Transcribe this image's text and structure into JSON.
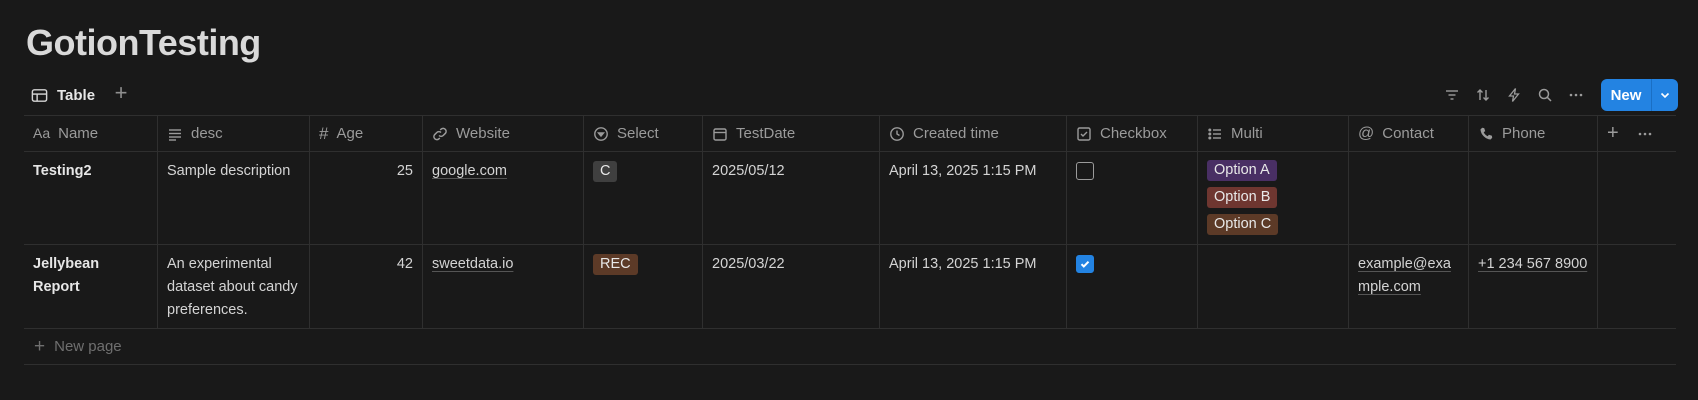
{
  "page": {
    "title": "GotionTesting"
  },
  "view": {
    "tab_label": "Table",
    "new_label": "New",
    "new_page_label": "New page"
  },
  "colors": {
    "accent": "#2383e2",
    "tag_gray": "#3f3f3f",
    "tag_brown": "#5c3a27",
    "tag_purple": "#492f64",
    "tag_red": "#6e3630"
  },
  "columns": {
    "name": "Name",
    "desc": "desc",
    "age": "Age",
    "website": "Website",
    "select": "Select",
    "testdate": "TestDate",
    "created": "Created time",
    "checkbox": "Checkbox",
    "multi": "Multi",
    "contact": "Contact",
    "phone": "Phone"
  },
  "rows": [
    {
      "name": "Testing2",
      "desc": "Sample description",
      "age": "25",
      "website": "google.com",
      "select": "C",
      "testdate": "2025/05/12",
      "created": "April 13, 2025 1:15 PM",
      "checked": false,
      "multi": [
        "Option A",
        "Option B",
        "Option C"
      ],
      "contact": "",
      "phone": ""
    },
    {
      "name": "Jellybean Report",
      "desc": "An experimental dataset about candy preferences.",
      "age": "42",
      "website": "sweetdata.io",
      "select": "REC",
      "testdate": "2025/03/22",
      "created": "April 13, 2025 1:15 PM",
      "checked": true,
      "multi": [],
      "contact": "example@example.com",
      "phone": "+1 234 567 8900"
    }
  ]
}
